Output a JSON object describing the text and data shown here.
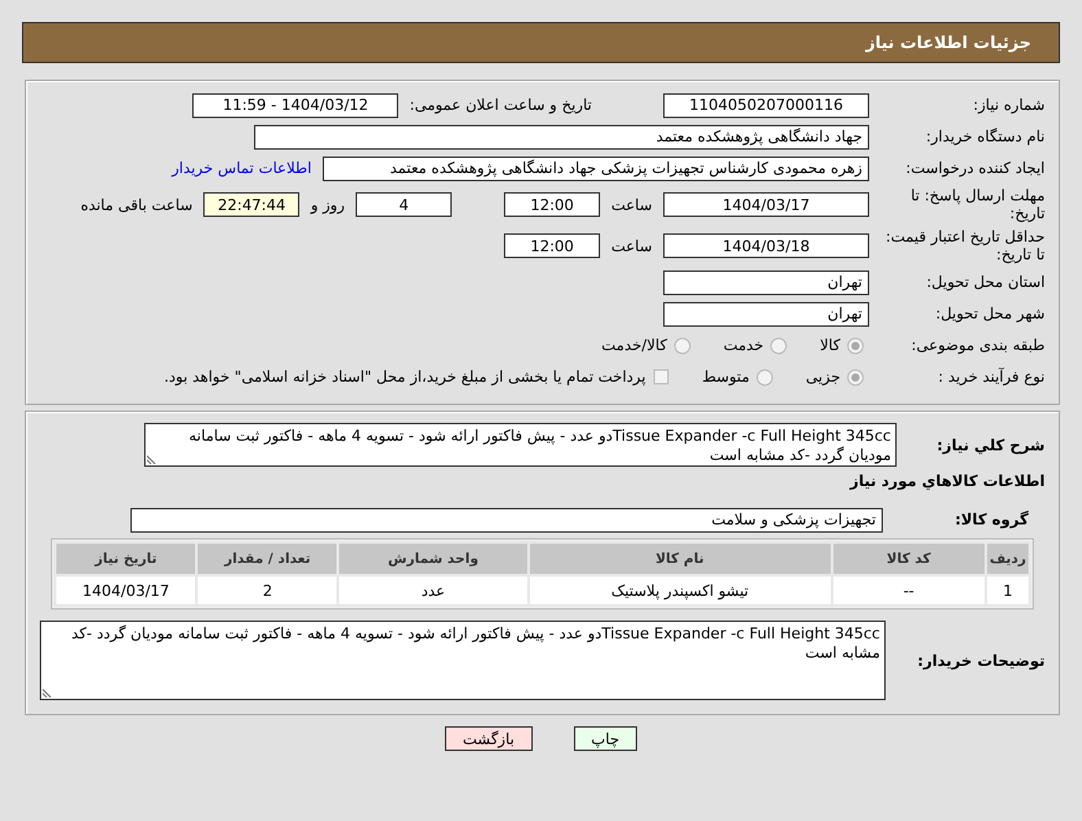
{
  "header": {
    "title": "جزئیات اطلاعات نیاز"
  },
  "need_number": {
    "label": "شماره نیاز:",
    "value": "1104050207000116"
  },
  "announce": {
    "label": "تاریخ و ساعت اعلان عمومی:",
    "value": "1404/03/12 - 11:59"
  },
  "buyer_org": {
    "label": "نام دستگاه خریدار:",
    "value": "جهاد دانشگاهی پژوهشکده معتمد"
  },
  "requester": {
    "label": "ایجاد کننده درخواست:",
    "value": "زهره محمودی کارشناس تجهیزات پزشکی جهاد دانشگاهی پژوهشکده معتمد",
    "link": "اطلاعات تماس خریدار"
  },
  "deadline": {
    "label": "مهلت ارسال پاسخ: تا تاریخ:",
    "date": "1404/03/17",
    "time_label": "ساعت",
    "time": "12:00",
    "days": "4",
    "days_label": "روز و",
    "remaining": "22:47:44",
    "remaining_label": "ساعت باقی مانده"
  },
  "validity": {
    "label": "حداقل تاریخ اعتبار قیمت: تا تاریخ:",
    "date": "1404/03/18",
    "time_label": "ساعت",
    "time": "12:00"
  },
  "province": {
    "label": "استان محل تحویل:",
    "value": "تهران"
  },
  "city": {
    "label": "شهر محل تحویل:",
    "value": "تهران"
  },
  "category": {
    "label": "طبقه بندی موضوعی:",
    "options": [
      {
        "label": "کالا",
        "selected": true
      },
      {
        "label": "خدمت",
        "selected": false
      },
      {
        "label": "کالا/خدمت",
        "selected": false
      }
    ]
  },
  "process": {
    "label": "نوع فرآیند خرید :",
    "options": [
      {
        "label": "جزیی",
        "selected": true
      },
      {
        "label": "متوسط",
        "selected": false
      }
    ],
    "treasury": {
      "label": "پرداخت تمام یا بخشی از مبلغ خرید،از محل \"اسناد خزانه اسلامی\" خواهد بود.",
      "checked": false
    }
  },
  "summary": {
    "label": "شرح کلي نياز:",
    "value": "Tissue Expander -c Full Height 345ccدو عدد - پیش فاکتور ارائه شود - تسویه 4 ماهه - فاکتور ثبت سامانه مودیان گردد -کد مشابه است"
  },
  "goods_title": "اطلاعات كالاهاي مورد نياز",
  "goods_group": {
    "label": "گروه کالا:",
    "value": "تجهیزات پزشکی و سلامت"
  },
  "table": {
    "columns": [
      "ردیف",
      "کد کالا",
      "نام کالا",
      "واحد شمارش",
      "تعداد / مقدار",
      "تاریخ نیاز"
    ],
    "rows": [
      [
        "1",
        "--",
        "تیشو اکسپندر پلاستیک",
        "عدد",
        "2",
        "1404/03/17"
      ]
    ]
  },
  "buyer_notes": {
    "label": "توضیحات خریدار:",
    "value": "Tissue Expander -c Full Height 345ccدو عدد - پیش فاکتور ارائه شود - تسویه 4 ماهه - فاکتور ثبت سامانه مودیان گردد -کد مشابه است"
  },
  "buttons": [
    {
      "label": "چاپ",
      "kind": "print"
    },
    {
      "label": "بازگشت",
      "kind": "back"
    }
  ]
}
